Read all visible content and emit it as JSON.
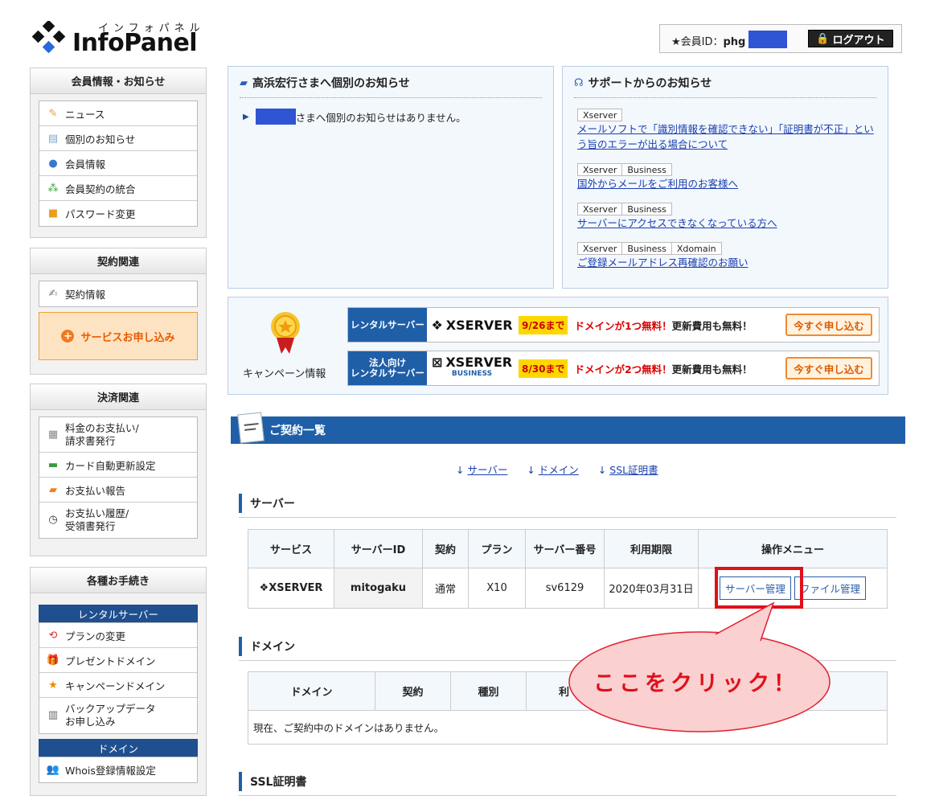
{
  "header": {
    "logo_kana": "インフォパネル",
    "logo_name": "InfoPanel",
    "member_label": "★会員ID：",
    "member_id": "phg",
    "logout_label": "ログアウト"
  },
  "sidebar": {
    "sections": [
      {
        "title": "会員情報・お知らせ",
        "items": [
          {
            "label": "ニュース",
            "icon": "news-icon"
          },
          {
            "label": "個別のお知らせ",
            "icon": "message-icon"
          },
          {
            "label": "会員情報",
            "icon": "user-icon"
          },
          {
            "label": "会員契約の統合",
            "icon": "merge-users-icon"
          },
          {
            "label": "パスワード変更",
            "icon": "lock-icon"
          }
        ]
      },
      {
        "title": "契約関連",
        "items": [
          {
            "label": "契約情報",
            "icon": "contract-icon"
          }
        ],
        "apply_label": "サービスお申し込み"
      },
      {
        "title": "決済関連",
        "items": [
          {
            "label": "料金のお支払い/\n請求書発行",
            "icon": "calculator-icon"
          },
          {
            "label": "カード自動更新設定",
            "icon": "credit-card-icon"
          },
          {
            "label": "お支払い報告",
            "icon": "report-icon"
          },
          {
            "label": "お支払い履歴/\n受領書発行",
            "icon": "clock-icon"
          }
        ]
      },
      {
        "title": "各種お手続き",
        "sub1": "レンタルサーバー",
        "items": [
          {
            "label": "プランの変更",
            "icon": "change-icon"
          },
          {
            "label": "プレゼントドメイン",
            "icon": "gift-icon"
          },
          {
            "label": "キャンペーンドメイン",
            "icon": "star-icon"
          },
          {
            "label": "バックアップデータ\nお申し込み",
            "icon": "backup-icon"
          }
        ],
        "sub2": "ドメイン",
        "items2": [
          {
            "label": "Whois登録情報設定",
            "icon": "whois-icon"
          }
        ]
      }
    ]
  },
  "personal_notice": {
    "title": "高浜宏行さまへ個別のお知らせ",
    "text": "さまへ個別のお知らせはありません。"
  },
  "support_notice": {
    "title": "サポートからのお知らせ",
    "items": [
      {
        "tags": [
          "Xserver"
        ],
        "text": "メールソフトで「識別情報を確認できない」「証明書が不正」という旨のエラーが出る場合について"
      },
      {
        "tags": [
          "Xserver",
          "Business"
        ],
        "text": "国外からメールをご利用のお客様へ"
      },
      {
        "tags": [
          "Xserver",
          "Business"
        ],
        "text": "サーバーにアクセスできなくなっている方へ"
      },
      {
        "tags": [
          "Xserver",
          "Business",
          "Xdomain"
        ],
        "text": "ご登録メールアドレス再確認のお願い"
      }
    ]
  },
  "campaign": {
    "label": "キャンペーン情報",
    "rows": [
      {
        "type": "レンタルサーバー",
        "brand": "XSERVER",
        "brand_sub": "",
        "deadline": "9/26まで",
        "msg_red": "ドメインが1つ無料！",
        "msg": "更新費用も無料！",
        "button": "今すぐ申し込む"
      },
      {
        "type": "法人向け\nレンタルサーバー",
        "brand": "XSERVER",
        "brand_sub": "BUSINESS",
        "deadline": "8/30まで",
        "msg_red": "ドメインが2つ無料！",
        "msg": "更新費用も無料！",
        "button": "今すぐ申し込む"
      }
    ]
  },
  "contracts": {
    "title": "ご契約一覧",
    "anchors": [
      "サーバー",
      "ドメイン",
      "SSL証明書"
    ],
    "server": {
      "heading": "サーバー",
      "columns": [
        "サービス",
        "サーバーID",
        "契約",
        "プラン",
        "サーバー番号",
        "利用期限",
        "操作メニュー"
      ],
      "row": {
        "service": "XSERVER",
        "server_id": "mitogaku",
        "contract": "通常",
        "plan": "X10",
        "server_no": "sv6129",
        "expiry": "2020年03月31日",
        "btn_manage": "サーバー管理",
        "btn_file": "ファイル管理"
      }
    },
    "domain": {
      "heading": "ドメイン",
      "columns": [
        "ドメイン",
        "契約",
        "種別",
        "利"
      ],
      "empty": "現在、ご契約中のドメインはありません。"
    },
    "ssl": {
      "heading": "SSL証明書"
    }
  },
  "callout": {
    "text": "ここをクリック！"
  },
  "colors": {
    "accent_blue": "#1f5fa8",
    "highlight_red": "#e0101a",
    "callout_pink": "#fbd0d0",
    "orange": "#e85a00"
  }
}
